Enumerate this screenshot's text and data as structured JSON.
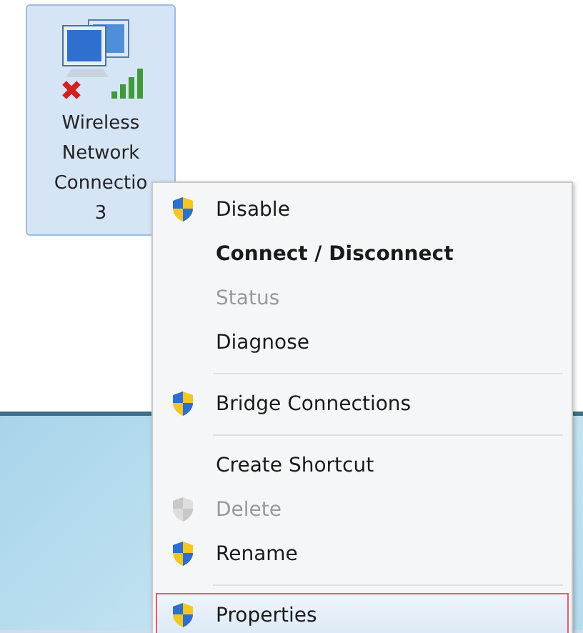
{
  "desktop_icon": {
    "label_lines": [
      "Wireless",
      "Network",
      "Connectio",
      "3"
    ],
    "selected": true
  },
  "context_menu": {
    "items": [
      {
        "kind": "item",
        "label": "Disable",
        "shield": true,
        "bold": false,
        "disabled": false,
        "selected": false
      },
      {
        "kind": "item",
        "label": "Connect / Disconnect",
        "shield": false,
        "bold": true,
        "disabled": false,
        "selected": false
      },
      {
        "kind": "item",
        "label": "Status",
        "shield": false,
        "bold": false,
        "disabled": true,
        "selected": false
      },
      {
        "kind": "item",
        "label": "Diagnose",
        "shield": false,
        "bold": false,
        "disabled": false,
        "selected": false
      },
      {
        "kind": "separator"
      },
      {
        "kind": "item",
        "label": "Bridge Connections",
        "shield": true,
        "bold": false,
        "disabled": false,
        "selected": false
      },
      {
        "kind": "separator"
      },
      {
        "kind": "item",
        "label": "Create Shortcut",
        "shield": false,
        "bold": false,
        "disabled": false,
        "selected": false
      },
      {
        "kind": "item",
        "label": "Delete",
        "shield": true,
        "bold": false,
        "disabled": true,
        "selected": false
      },
      {
        "kind": "item",
        "label": "Rename",
        "shield": true,
        "bold": false,
        "disabled": false,
        "selected": false
      },
      {
        "kind": "separator"
      },
      {
        "kind": "item",
        "label": "Properties",
        "shield": true,
        "bold": false,
        "disabled": false,
        "selected": true
      }
    ]
  }
}
